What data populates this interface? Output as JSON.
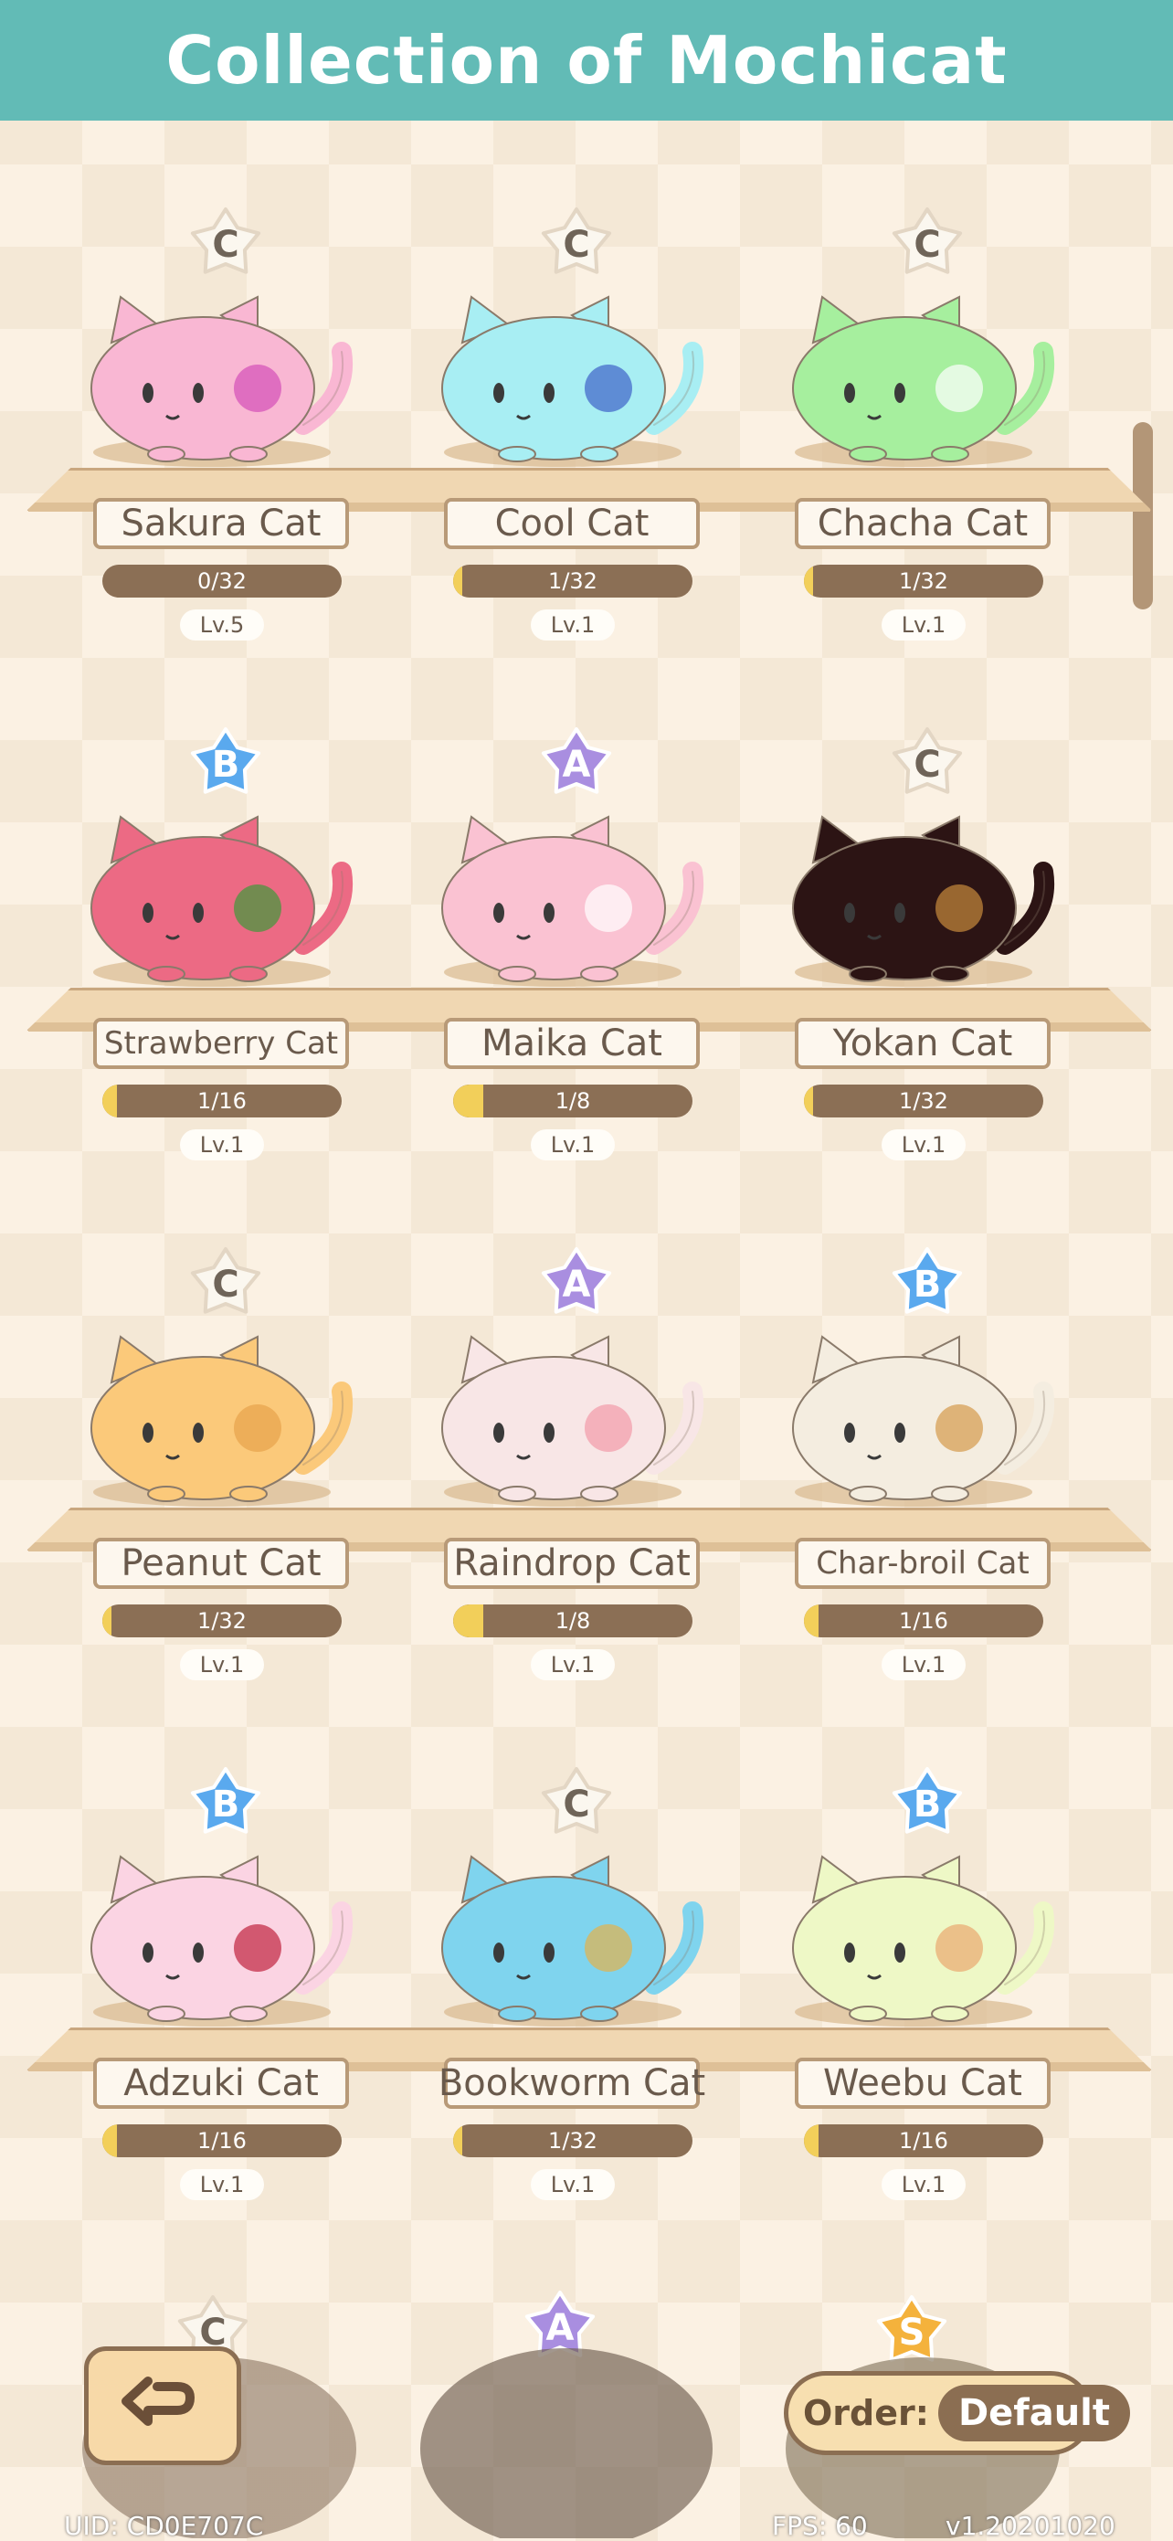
{
  "header": {
    "title": "Collection of Mochicat"
  },
  "cats": [
    {
      "name": "Sakura Cat",
      "rank": "C",
      "progress": "0/32",
      "fill": 0.0,
      "level": "Lv.5",
      "body": "#f9b7d3",
      "accent": "#d44fb8",
      "ear": "#f9b7d3"
    },
    {
      "name": "Cool Cat",
      "rank": "C",
      "progress": "1/32",
      "fill": 0.03,
      "level": "Lv.1",
      "body": "#a8eef3",
      "accent": "#3f63c8",
      "ear": "#a8eef3"
    },
    {
      "name": "Chacha Cat",
      "rank": "C",
      "progress": "1/32",
      "fill": 0.03,
      "level": "Lv.1",
      "body": "#a6ef9e",
      "accent": "#ffffff",
      "ear": "#a6ef9e"
    },
    {
      "name": "Strawberry Cat",
      "rank": "B",
      "progress": "1/16",
      "fill": 0.06,
      "level": "Lv.1",
      "body": "#ec6a84",
      "accent": "#3e9a3a",
      "ear": "#ec6a84"
    },
    {
      "name": "Maika Cat",
      "rank": "A",
      "progress": "1/8",
      "fill": 0.125,
      "level": "Lv.1",
      "body": "#fac2d2",
      "accent": "#ffffff",
      "ear": "#fac2d2"
    },
    {
      "name": "Yokan Cat",
      "rank": "C",
      "progress": "1/32",
      "fill": 0.03,
      "level": "Lv.1",
      "body": "#2c1414",
      "accent": "#c78a3c",
      "ear": "#2c1414"
    },
    {
      "name": "Peanut Cat",
      "rank": "C",
      "progress": "1/32",
      "fill": 0.03,
      "level": "Lv.1",
      "body": "#fbc97a",
      "accent": "#e7a24c",
      "ear": "#fbc97a"
    },
    {
      "name": "Raindrop Cat",
      "rank": "A",
      "progress": "1/8",
      "fill": 0.125,
      "level": "Lv.1",
      "body": "#f8e6e6",
      "accent": "#f29aa8",
      "ear": "#f8e6e6"
    },
    {
      "name": "Char-broil Cat",
      "rank": "B",
      "progress": "1/16",
      "fill": 0.06,
      "level": "Lv.1",
      "body": "#f4ede0",
      "accent": "#d49a4c",
      "ear": "#f4ede0"
    },
    {
      "name": "Adzuki Cat",
      "rank": "B",
      "progress": "1/16",
      "fill": 0.06,
      "level": "Lv.1",
      "body": "#fbd4e3",
      "accent": "#c0243e",
      "ear": "#fbd4e3"
    },
    {
      "name": "Bookworm Cat",
      "rank": "C",
      "progress": "1/32",
      "fill": 0.03,
      "level": "Lv.1",
      "body": "#7fd4ee",
      "accent": "#e3b24c",
      "ear": "#7fd4ee"
    },
    {
      "name": "Weebu Cat",
      "rank": "B",
      "progress": "1/16",
      "fill": 0.06,
      "level": "Lv.1",
      "body": "#eef8c6",
      "accent": "#e9a86f",
      "ear": "#eef8c6"
    }
  ],
  "bottom_row_ranks": [
    "C",
    "A",
    "S"
  ],
  "colors": {
    "rank_C": "#fbf7ef",
    "rank_B": "#5aa9ee",
    "rank_A": "#a98ee0",
    "rank_S": "#f4b23c"
  },
  "controls": {
    "back_icon": "back-arrow-icon",
    "order_label": "Order:",
    "order_value": "Default"
  },
  "footer": {
    "uid": "UID: CD0E707C",
    "fps": "FPS: 60",
    "version": "v1.20201020"
  }
}
